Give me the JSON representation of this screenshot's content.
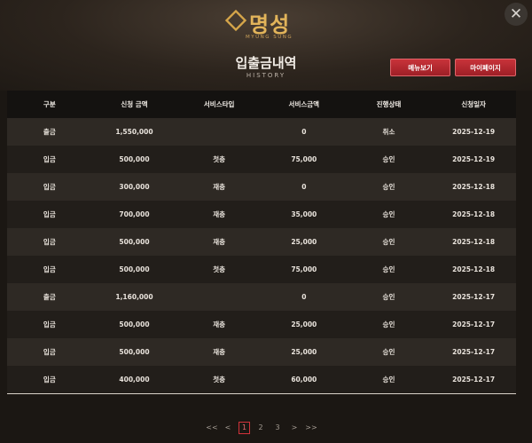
{
  "brand": {
    "name": "명성",
    "sub": "MYUNG SUNG"
  },
  "close_glyph": "✕",
  "header": {
    "title": "입출금내역",
    "subtitle": "HISTORY"
  },
  "buttons": {
    "menu": "메뉴보기",
    "mypage": "마이페이지"
  },
  "table": {
    "columns": [
      "구분",
      "신청 금액",
      "서비스타입",
      "서비스금액",
      "진행상태",
      "신청일자"
    ],
    "rows": [
      [
        "출금",
        "1,550,000",
        "",
        "0",
        "취소",
        "2025-12-19"
      ],
      [
        "입금",
        "500,000",
        "첫충",
        "75,000",
        "승인",
        "2025-12-19"
      ],
      [
        "입금",
        "300,000",
        "재충",
        "0",
        "승인",
        "2025-12-18"
      ],
      [
        "입금",
        "700,000",
        "재충",
        "35,000",
        "승인",
        "2025-12-18"
      ],
      [
        "입금",
        "500,000",
        "재충",
        "25,000",
        "승인",
        "2025-12-18"
      ],
      [
        "입금",
        "500,000",
        "첫충",
        "75,000",
        "승인",
        "2025-12-18"
      ],
      [
        "출금",
        "1,160,000",
        "",
        "0",
        "승인",
        "2025-12-17"
      ],
      [
        "입금",
        "500,000",
        "재충",
        "25,000",
        "승인",
        "2025-12-17"
      ],
      [
        "입금",
        "500,000",
        "재충",
        "25,000",
        "승인",
        "2025-12-17"
      ],
      [
        "입금",
        "400,000",
        "첫충",
        "60,000",
        "승인",
        "2025-12-17"
      ]
    ]
  },
  "pagination": {
    "first": "<<",
    "prev": "<",
    "pages": [
      "1",
      "2",
      "3"
    ],
    "current": "1",
    "next": ">",
    "last": ">>"
  },
  "colors": {
    "accent_red": "#c8333a",
    "gold": "#e2b45a",
    "background": "#1b1713"
  }
}
